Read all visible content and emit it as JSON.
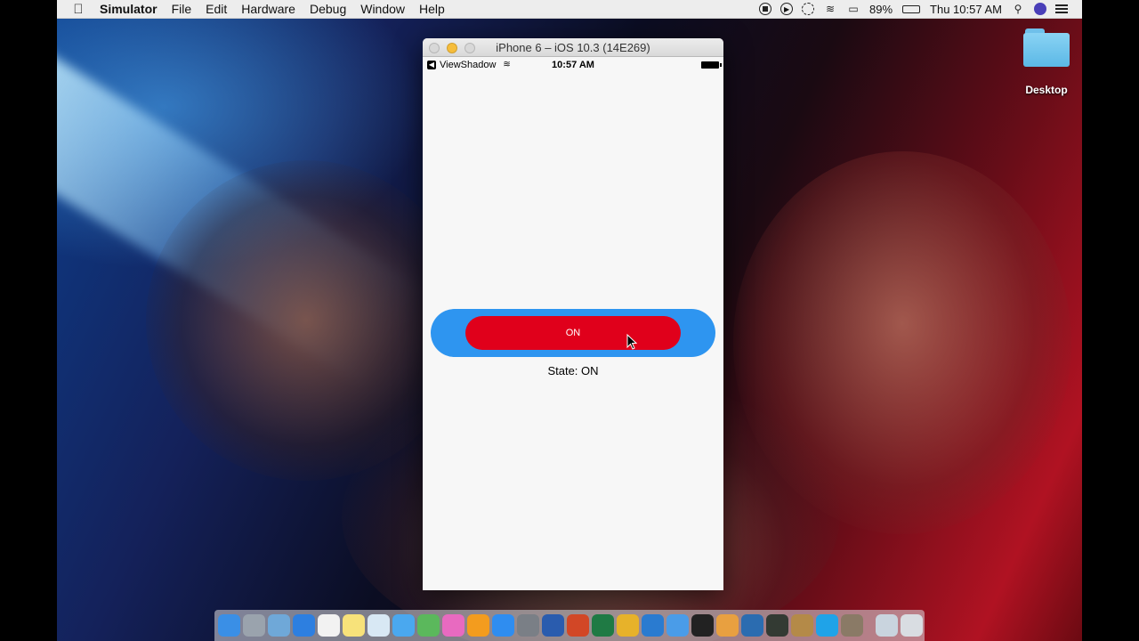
{
  "menubar": {
    "app_name": "Simulator",
    "menus": [
      "File",
      "Edit",
      "Hardware",
      "Debug",
      "Window",
      "Help"
    ],
    "battery_percent": "89%",
    "clock": "Thu 10:57 AM"
  },
  "desktop": {
    "folder_label": "Desktop"
  },
  "simulator": {
    "window_title": "iPhone 6 – iOS 10.3 (14E269)",
    "status_bar": {
      "back_app": "ViewShadow",
      "time": "10:57 AM"
    },
    "app": {
      "button_label": "ON",
      "state_text": "State: ON"
    },
    "colors": {
      "shadow_view": "#2e95f0",
      "button": "#e0001b"
    }
  },
  "dock": {
    "apps": [
      {
        "name": "finder",
        "color": "#3a8fe6"
      },
      {
        "name": "launchpad",
        "color": "#9aa3ad"
      },
      {
        "name": "preview",
        "color": "#6fa8d8"
      },
      {
        "name": "safari",
        "color": "#2d7fe0"
      },
      {
        "name": "calendar",
        "color": "#f2f2f2"
      },
      {
        "name": "notes",
        "color": "#f7e27a"
      },
      {
        "name": "photos-viewer",
        "color": "#d8e8f4"
      },
      {
        "name": "messages",
        "color": "#4aa8ef"
      },
      {
        "name": "android-studio",
        "color": "#5bb85c"
      },
      {
        "name": "itunes",
        "color": "#e86ac0"
      },
      {
        "name": "ibooks",
        "color": "#f39c1e"
      },
      {
        "name": "app-store",
        "color": "#2f8df0"
      },
      {
        "name": "system-preferences",
        "color": "#7a7f86"
      },
      {
        "name": "word",
        "color": "#2a5cae"
      },
      {
        "name": "powerpoint",
        "color": "#d24726"
      },
      {
        "name": "excel",
        "color": "#1f7a44"
      },
      {
        "name": "chrome",
        "color": "#e7b22a"
      },
      {
        "name": "visual-studio-code",
        "color": "#2a7bd0"
      },
      {
        "name": "xcode",
        "color": "#4a9ce8"
      },
      {
        "name": "terminal",
        "color": "#222222"
      },
      {
        "name": "pencil",
        "color": "#e8a040"
      },
      {
        "name": "quicktime",
        "color": "#2b6cb0"
      },
      {
        "name": "activity-monitor",
        "color": "#333a33"
      },
      {
        "name": "sequel",
        "color": "#b48a48"
      },
      {
        "name": "skype",
        "color": "#1fa3e8"
      },
      {
        "name": "gimp",
        "color": "#8a7a66"
      },
      {
        "name": "downloads",
        "color": "#c9d4de"
      },
      {
        "name": "trash",
        "color": "#d9dde2"
      }
    ]
  }
}
